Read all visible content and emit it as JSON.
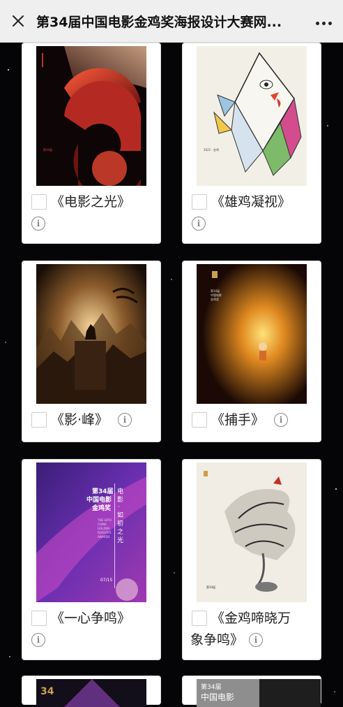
{
  "header": {
    "title": "第34届中国电影金鸡奖海报设计大赛网...",
    "close_icon": "close-icon",
    "more_icon": "more-dots-icon"
  },
  "posters": [
    {
      "label": "《电影之光》"
    },
    {
      "label": "《雄鸡凝视》"
    },
    {
      "label": "《影·峰》"
    },
    {
      "label": "《捕手》"
    },
    {
      "label": "《一心争鸣》"
    },
    {
      "label_line1": "《金鸡啼晓万",
      "label_line2": "象争鸣》"
    }
  ],
  "poster_text": {
    "p5_title": "第34届\n中国电影\n金鸡奖",
    "p5_vertical": "电影·如初之光",
    "p5_en": "THE 34TH CHINA GOLDEN ROOSTER AWARDS",
    "p5_date": "07/15",
    "p7_title": "第34届\n中国电影"
  },
  "colors": {
    "accent_red": "#c4302b",
    "page_bg": "#050507",
    "card_bg": "#ffffff",
    "topbar_bg": "#efefef"
  }
}
